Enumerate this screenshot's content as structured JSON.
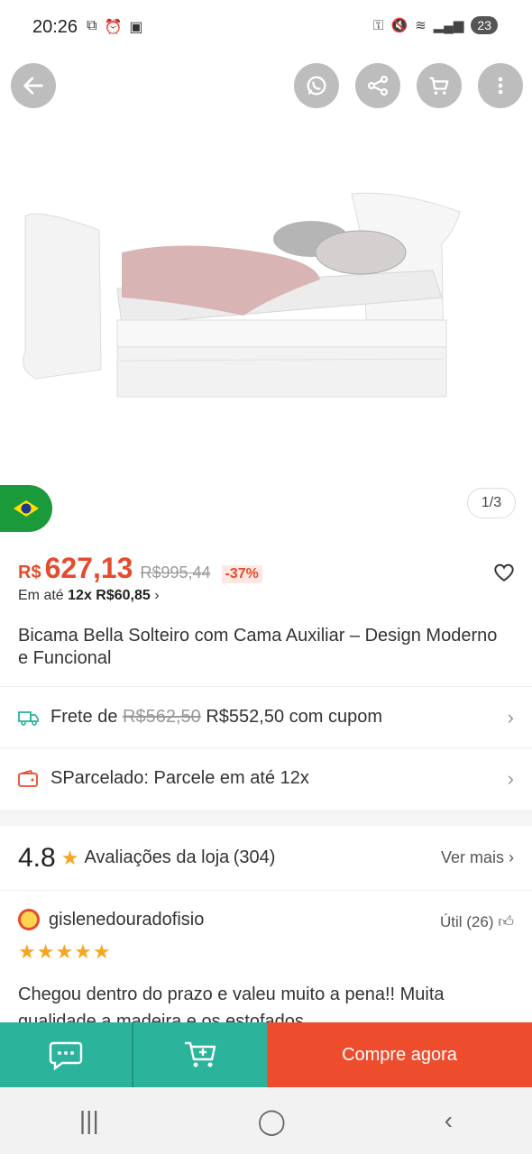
{
  "status": {
    "time": "20:26",
    "battery": "23"
  },
  "gallery": {
    "counter": "1/3"
  },
  "price": {
    "currency": "R$",
    "value": "627,13",
    "old": "R$995,44",
    "discount": "-37%",
    "installment_prefix": "Em até",
    "installment_value": "12x R$60,85"
  },
  "product": {
    "title": "Bicama Bella Solteiro com Cama Auxiliar – Design Moderno e Funcional"
  },
  "shipping": {
    "prefix": "Frete de",
    "old": "R$562,50",
    "new": "R$552,50 com cupom"
  },
  "parcel": {
    "label": "SParcelado: Parcele em até 12x"
  },
  "reviews": {
    "rating": "4.8",
    "label": "Avaliações da loja",
    "count": "(304)",
    "more": "Ver mais",
    "first": {
      "user": "gislenedouradofisio",
      "helpful": "Útil (26)",
      "stars": "★★★★★",
      "text": "Chegou dentro do prazo e valeu muito a pena!! Muita qualidade a madeira e os estofados"
    }
  },
  "actions": {
    "buy": "Compre agora"
  },
  "colors": {
    "accent": "#ee4d2d",
    "teal": "#2bb39c",
    "star": "#f6a623"
  }
}
